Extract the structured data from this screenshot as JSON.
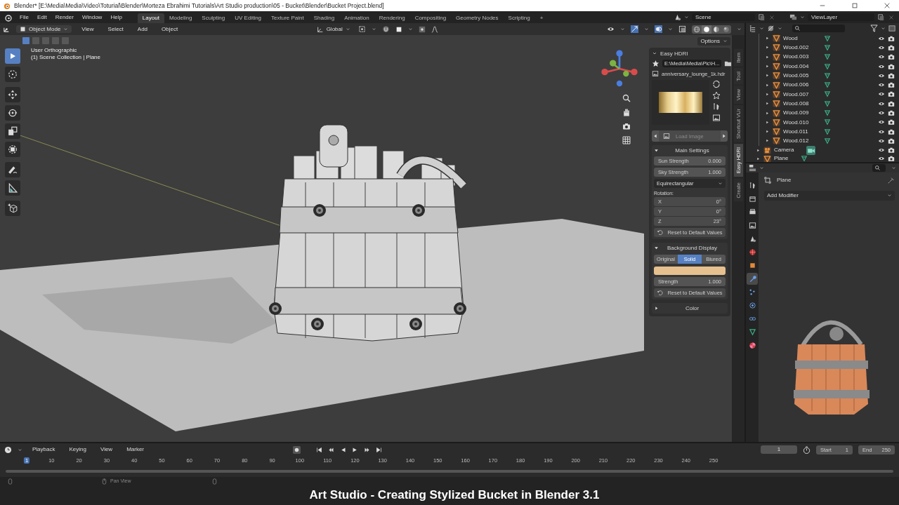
{
  "window": {
    "title": "Blender* [E:\\Media\\Media\\Video\\Toturial\\Blender\\Morteza Ebrahimi Tutorials\\Art Studio production\\05 - Bucket\\Blender\\Bucket Project.blend]"
  },
  "menu_bar": [
    "File",
    "Edit",
    "Render",
    "Window",
    "Help"
  ],
  "workspace_tabs": [
    {
      "label": "Layout",
      "selected": true
    },
    {
      "label": "Modeling",
      "selected": false
    },
    {
      "label": "Sculpting",
      "selected": false
    },
    {
      "label": "UV Editing",
      "selected": false
    },
    {
      "label": "Texture Paint",
      "selected": false
    },
    {
      "label": "Shading",
      "selected": false
    },
    {
      "label": "Animation",
      "selected": false
    },
    {
      "label": "Rendering",
      "selected": false
    },
    {
      "label": "Compositing",
      "selected": false
    },
    {
      "label": "Geometry Nodes",
      "selected": false
    },
    {
      "label": "Scripting",
      "selected": false
    }
  ],
  "add_workspace": "+",
  "scene": "Scene",
  "view_layer": "ViewLayer",
  "viewport": {
    "mode": "Object Mode",
    "menus": [
      "View",
      "Select",
      "Add",
      "Object"
    ],
    "orientation": "Global",
    "select_modes": [
      {
        "selected": true
      },
      {
        "selected": false
      },
      {
        "selected": false
      },
      {
        "selected": false
      },
      {
        "selected": false
      }
    ],
    "shading": [
      {
        "kind": "wireframe",
        "selected": false
      },
      {
        "kind": "solid",
        "selected": true
      },
      {
        "kind": "material",
        "selected": false
      },
      {
        "kind": "rendered",
        "selected": false
      }
    ],
    "options": "Options",
    "info": [
      "User Orthographic",
      "(1) Scene Collection | Plane"
    ],
    "tools": [
      {
        "kind": "select",
        "selected": true
      },
      {
        "kind": "cursor",
        "selected": false
      },
      {
        "kind": "move",
        "selected": false
      },
      {
        "kind": "rotate",
        "selected": false
      },
      {
        "kind": "scale",
        "selected": false
      },
      {
        "kind": "transform",
        "selected": false
      },
      {
        "kind": "annotate",
        "selected": false
      },
      {
        "kind": "measure",
        "selected": false
      },
      {
        "kind": "add-cube",
        "selected": false
      }
    ]
  },
  "easy_hdri": {
    "title": "Easy HDRI",
    "path": "E:\\Media\\Media\\Pic\\H...",
    "file": "anniversary_lounge_1k.hdr",
    "load_button": {
      "label": "Load Image",
      "disabled": true
    },
    "main_settings": {
      "title": "Main Settings",
      "expanded": true,
      "fields": [
        {
          "label": "Sun Strength",
          "value": "0.000"
        },
        {
          "label": "Sky Strength",
          "value": "1.000"
        }
      ],
      "projection": "Equirectangular",
      "rotation_label": "Rotation:",
      "rotation": [
        {
          "label": "X",
          "value": "0°"
        },
        {
          "label": "Y",
          "value": "0°"
        },
        {
          "label": "Z",
          "value": "23°"
        }
      ],
      "reset": "Reset to Default Values"
    },
    "background_display": {
      "title": "Background Display",
      "expanded": true,
      "modes": [
        {
          "label": "Original",
          "selected": false
        },
        {
          "label": "Solid",
          "selected": true
        },
        {
          "label": "Blured",
          "selected": false
        }
      ],
      "color": "#e6c08f",
      "strength": {
        "label": "Strength",
        "value": "1.000"
      },
      "reset": "Reset to Default Values"
    },
    "color_section": {
      "title": "Color",
      "expanded": false
    }
  },
  "sidebar_tabs": [
    {
      "label": "Item",
      "selected": false
    },
    {
      "label": "Tool",
      "selected": false
    },
    {
      "label": "View",
      "selected": false
    },
    {
      "label": "Shortcut VUr",
      "selected": false
    },
    {
      "label": "Easy HDRI",
      "selected": true
    },
    {
      "label": "Create",
      "selected": false
    }
  ],
  "outliner": {
    "nested_items": [
      {
        "label": "Wood",
        "expanded": false
      },
      {
        "label": "Wood.002",
        "expanded": false
      },
      {
        "label": "Wood.003",
        "expanded": false
      },
      {
        "label": "Wood.004",
        "expanded": false
      },
      {
        "label": "Wood.005",
        "expanded": false
      },
      {
        "label": "Wood.006",
        "expanded": false
      },
      {
        "label": "Wood.007",
        "expanded": false
      },
      {
        "label": "Wood.008",
        "expanded": false
      },
      {
        "label": "Wood.009",
        "expanded": false
      },
      {
        "label": "Wood.010",
        "expanded": false
      },
      {
        "label": "Wood.011",
        "expanded": false
      },
      {
        "label": "Wood.012",
        "expanded": false
      }
    ],
    "items": [
      {
        "label": "Camera",
        "kind": "camera",
        "expanded": false
      },
      {
        "label": "Plane",
        "kind": "mesh",
        "expanded": false
      }
    ]
  },
  "properties": {
    "object": "Plane",
    "add_modifier": "Add Modifier",
    "tabs": [
      {
        "kind": "tool",
        "selected": false
      },
      {
        "kind": "output",
        "selected": false
      },
      {
        "kind": "render",
        "selected": false
      },
      {
        "kind": "image",
        "selected": false
      },
      {
        "kind": "scene",
        "selected": false
      },
      {
        "kind": "world",
        "selected": false
      },
      {
        "kind": "object",
        "selected": false
      },
      {
        "kind": "modifiers",
        "selected": true
      },
      {
        "kind": "particles",
        "selected": false
      },
      {
        "kind": "physics",
        "selected": false
      },
      {
        "kind": "constraints",
        "selected": false
      },
      {
        "kind": "data",
        "selected": false
      },
      {
        "kind": "material",
        "selected": false
      }
    ]
  },
  "timeline": {
    "menus": [
      "Playback",
      "Keying",
      "View",
      "Marker"
    ],
    "current_frame": "1",
    "start": {
      "label": "Start",
      "value": "1"
    },
    "end": {
      "label": "End",
      "value": "250"
    },
    "ticks": [
      {
        "label": "1",
        "selected": true
      },
      {
        "label": "10",
        "selected": false
      },
      {
        "label": "20",
        "selected": false
      },
      {
        "label": "30",
        "selected": false
      },
      {
        "label": "40",
        "selected": false
      },
      {
        "label": "50",
        "selected": false
      },
      {
        "label": "60",
        "selected": false
      },
      {
        "label": "70",
        "selected": false
      },
      {
        "label": "80",
        "selected": false
      },
      {
        "label": "90",
        "selected": false
      },
      {
        "label": "100",
        "selected": false
      },
      {
        "label": "110",
        "selected": false
      },
      {
        "label": "120",
        "selected": false
      },
      {
        "label": "130",
        "selected": false
      },
      {
        "label": "140",
        "selected": false
      },
      {
        "label": "150",
        "selected": false
      },
      {
        "label": "160",
        "selected": false
      },
      {
        "label": "170",
        "selected": false
      },
      {
        "label": "180",
        "selected": false
      },
      {
        "label": "190",
        "selected": false
      },
      {
        "label": "200",
        "selected": false
      },
      {
        "label": "210",
        "selected": false
      },
      {
        "label": "220",
        "selected": false
      },
      {
        "label": "230",
        "selected": false
      },
      {
        "label": "240",
        "selected": false
      },
      {
        "label": "250",
        "selected": false
      }
    ]
  },
  "status_bar": {
    "hint": "Pan View"
  },
  "caption": "Art Studio - Creating Stylized Bucket in Blender 3.1"
}
